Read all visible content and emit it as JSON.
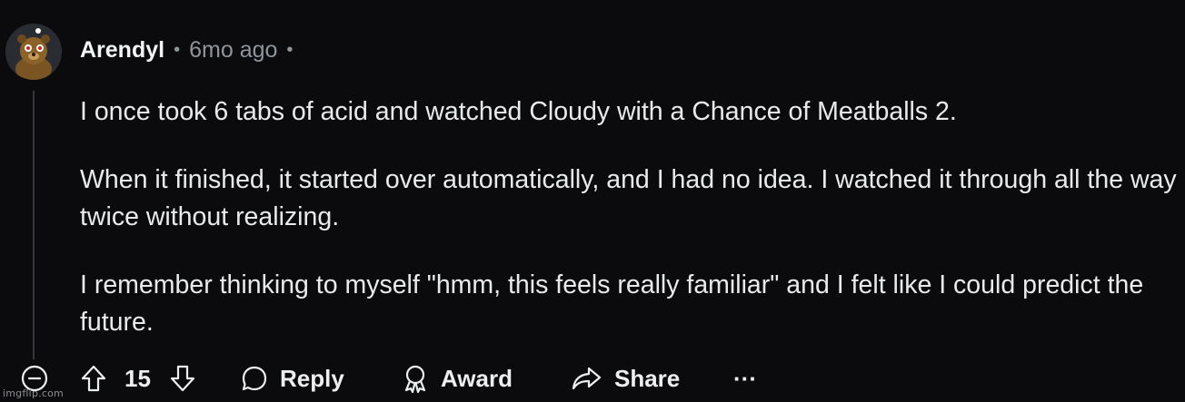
{
  "comment": {
    "author": "Arendyl",
    "age": "6mo ago",
    "separator": "•",
    "paragraphs": [
      "I once took 6 tabs of acid and watched Cloudy with a Chance of Meatballs 2.",
      "When it finished, it started over automatically, and I had no idea. I watched it through all the way twice without realizing.",
      "I remember thinking to myself \"hmm, this feels really familiar\" and I felt like I could predict the future."
    ]
  },
  "actions": {
    "score": "15",
    "reply_label": "Reply",
    "award_label": "Award",
    "share_label": "Share",
    "more_label": "···"
  },
  "watermark": "imgflip.com",
  "colors": {
    "background": "#0b0b0d",
    "text": "#e8eaec",
    "muted": "#8e959b",
    "thread_line": "#34373d"
  }
}
